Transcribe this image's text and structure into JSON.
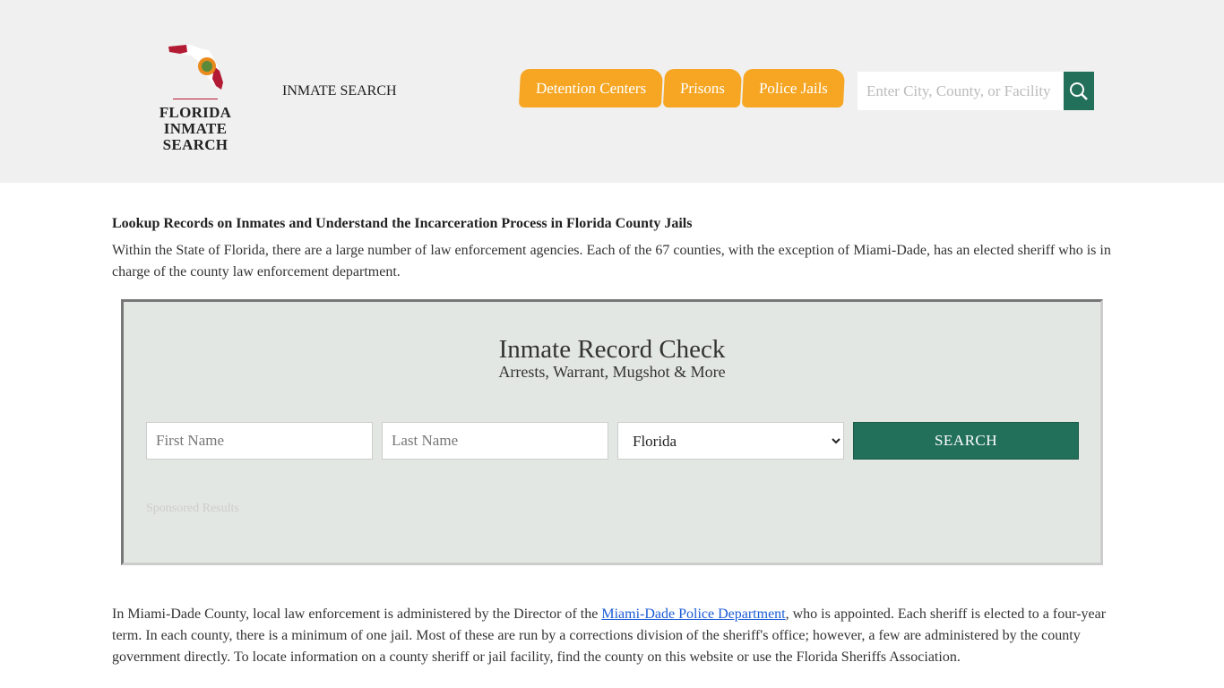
{
  "header": {
    "logo_line1": "FLORIDA",
    "logo_line2": "INMATE SEARCH",
    "site_title": "INMATE SEARCH",
    "nav": [
      {
        "label": "Detention Centers"
      },
      {
        "label": "Prisons"
      },
      {
        "label": "Police Jails"
      }
    ],
    "search_placeholder": "Enter City, County, or Facility",
    "search_icon": "magnifier-icon"
  },
  "main": {
    "heading": "Lookup Records on Inmates and Understand the Incarceration Process in Florida County Jails",
    "intro": "Within the State of Florida, there are a large number of law enforcement agencies. Each of the 67 counties, with the exception of Miami-Dade, has an elected sheriff who is in charge of the county law enforcement department.",
    "box": {
      "title": "Inmate Record Check",
      "subtitle": "Arrests, Warrant, Mugshot & More",
      "first_placeholder": "First Name",
      "last_placeholder": "Last Name",
      "state": "Florida",
      "search_label": "SEARCH",
      "sponsored": "Sponsored Results"
    },
    "p2_before": "In Miami-Dade County, local law enforcement is administered by the Director of the ",
    "p2_link": "Miami-Dade Police Department",
    "p2_after": ", who is appointed. Each sheriff is elected to a four-year term. In each county, there is a minimum of one jail. Most of these are run by a corrections division of the sheriff's office; however, a few are administered by the county government directly. To locate information on a county sheriff or jail facility, find the county on this website or use the Florida Sheriffs Association."
  },
  "colors": {
    "accent": "#f6a623",
    "green": "#23705a",
    "box_bg": "#e3e7e3"
  }
}
